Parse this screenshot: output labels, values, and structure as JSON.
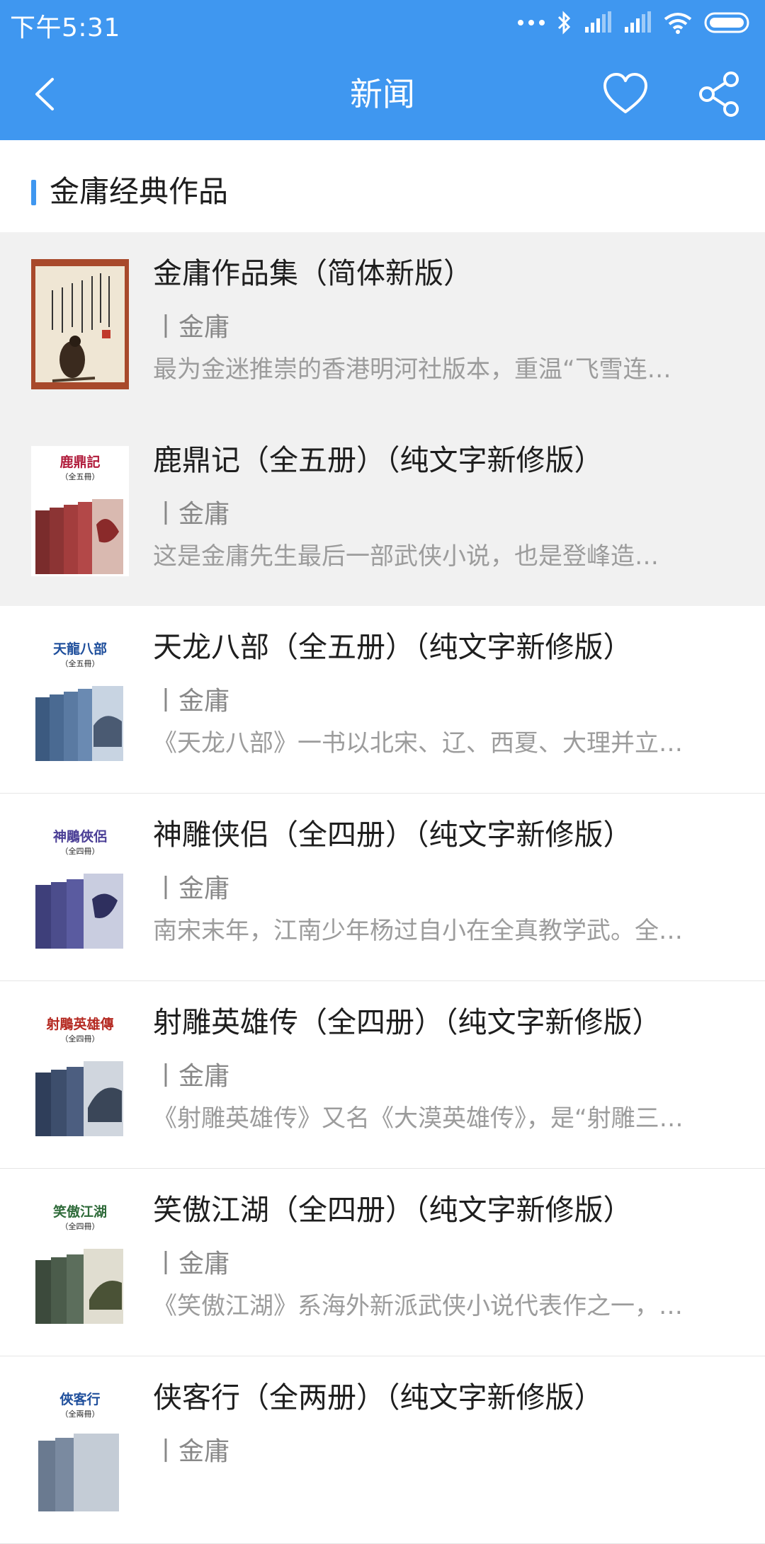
{
  "status_bar": {
    "time": "下午5:31"
  },
  "app_bar": {
    "title": "新闻"
  },
  "section": {
    "title": "金庸经典作品"
  },
  "books": [
    {
      "title": "金庸作品集（简体新版）",
      "author": "丨金庸",
      "desc": "最为金迷推崇的香港明河社版本，重温“飞雪连…",
      "cover_color": "#c9b89a"
    },
    {
      "title": "鹿鼎记（全五册）（纯文字新修版）",
      "author": "丨金庸",
      "desc": "这是金庸先生最后一部武侠小说，也是登峰造…",
      "cover_title": "鹿鼎記",
      "cover_sub": "（全五冊）",
      "cover_color": "#b01a3a"
    },
    {
      "title": "天龙八部（全五册）（纯文字新修版）",
      "author": "丨金庸",
      "desc": "《天龙八部》一书以北宋、辽、西夏、大理并立…",
      "cover_title": "天龍八部",
      "cover_sub": "（全五冊）",
      "cover_color": "#1f4f9c"
    },
    {
      "title": "神雕侠侣（全四册）（纯文字新修版）",
      "author": "丨金庸",
      "desc": "南宋末年，江南少年杨过自小在全真教学武。全…",
      "cover_title": "神鵰俠侶",
      "cover_sub": "（全四冊）",
      "cover_color": "#4b3f96"
    },
    {
      "title": "射雕英雄传（全四册）（纯文字新修版）",
      "author": "丨金庸",
      "desc": "《射雕英雄传》又名《大漠英雄传》，是“射雕三…",
      "cover_title": "射鵰英雄傳",
      "cover_sub": "（全四冊）",
      "cover_color": "#b52a22"
    },
    {
      "title": "笑傲江湖（全四册）（纯文字新修版）",
      "author": "丨金庸",
      "desc": "《笑傲江湖》系海外新派武侠小说代表作之一，…",
      "cover_title": "笑傲江湖",
      "cover_sub": "（全四冊）",
      "cover_color": "#2f6b3a"
    },
    {
      "title": "侠客行（全两册）（纯文字新修版）",
      "author": "丨金庸",
      "desc": "",
      "cover_title": "俠客行",
      "cover_sub": "（全兩冊）",
      "cover_color": "#1f4f9c"
    }
  ]
}
